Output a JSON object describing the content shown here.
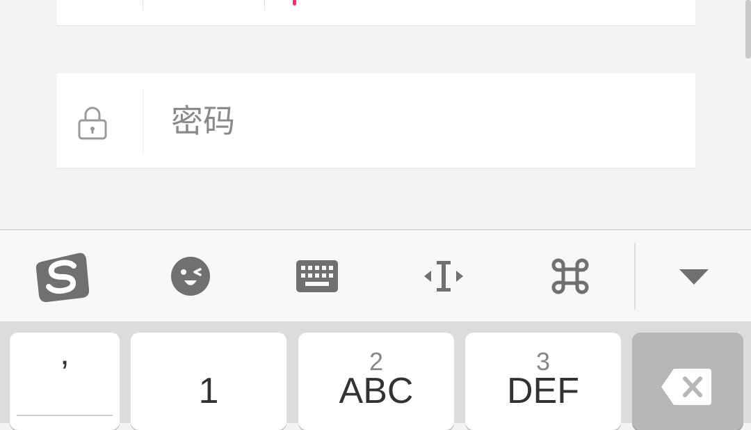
{
  "form": {
    "password_placeholder": "密码"
  },
  "toolbar": {
    "items": [
      "sogou-logo",
      "emoji",
      "keyboard",
      "cursor-move",
      "command",
      "collapse"
    ]
  },
  "keyboard": {
    "keys": [
      {
        "main": "’",
        "sub": ""
      },
      {
        "main": "1",
        "sub": ""
      },
      {
        "main": "ABC",
        "sub": "2"
      },
      {
        "main": "DEF",
        "sub": "3"
      },
      {
        "main": "",
        "sub": "",
        "icon": "backspace-icon"
      }
    ]
  },
  "colors": {
    "accent_caret": "#ff2d6f",
    "brand_icon": "#707070"
  }
}
